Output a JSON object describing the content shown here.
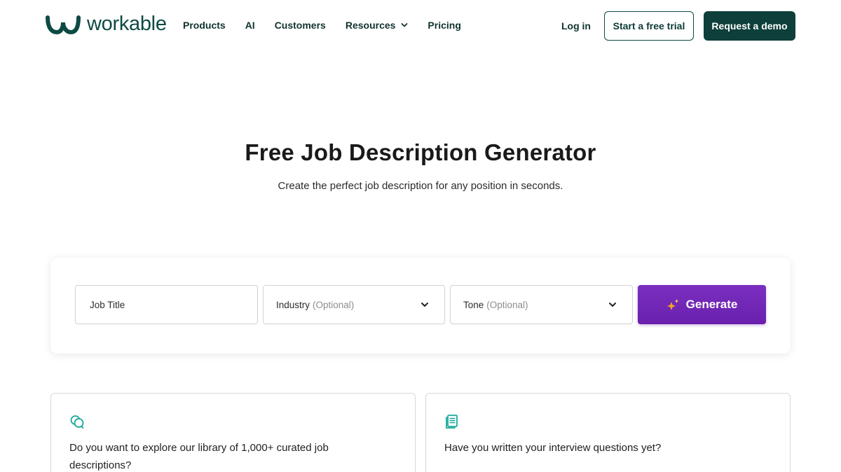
{
  "header": {
    "logo_text": "workable",
    "nav": {
      "products": "Products",
      "ai": "AI",
      "customers": "Customers",
      "resources": "Resources",
      "pricing": "Pricing"
    },
    "login": "Log in",
    "trial_button": "Start a free trial",
    "demo_button": "Request a demo"
  },
  "hero": {
    "title": "Free Job Description Generator",
    "subtitle": "Create the perfect job description for any position in seconds."
  },
  "generator": {
    "job_title_placeholder": "Job Title",
    "industry_label": "Industry",
    "industry_optional": "(Optional)",
    "tone_label": "Tone",
    "tone_optional": "(Optional)",
    "generate_label": "Generate"
  },
  "info_cards": [
    {
      "text": "Do you want to explore our library of 1,000+ curated job descriptions?",
      "icon": "chat-bubbles-icon"
    },
    {
      "text": "Have you written your interview questions yet?",
      "icon": "document-icon"
    }
  ],
  "colors": {
    "brand_dark": "#0e3f3a",
    "brand_teal": "#1aa99a",
    "generate_purple": "#6f25b5",
    "sparkle_orange": "#f5a623"
  }
}
